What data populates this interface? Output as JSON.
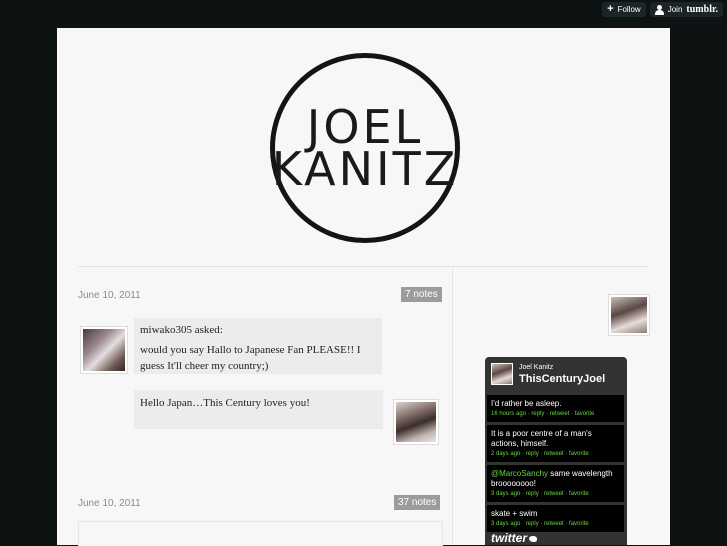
{
  "tumblr_controls": {
    "follow_label": "Follow",
    "join_label": "Join",
    "tumblr_label": "tumblr."
  },
  "logo": {
    "line1": "JOEL",
    "line2": "KANITZ"
  },
  "posts": [
    {
      "date": "June 10, 2011",
      "notes": "7 notes",
      "asker": "miwako305 asked:",
      "question": "would you say Hallo to Japanese Fan PLEASE!! I guess It'll cheer my country;)",
      "answer": "Hello Japan…This Century loves you!"
    },
    {
      "date": "June 10, 2011",
      "notes": "37 notes"
    }
  ],
  "twitter": {
    "name": "Joel Kanitz",
    "handle": "ThisCenturyJoel",
    "tweets": [
      {
        "text": "I'd rather be asleep.",
        "meta": "16 hours ago · reply · retweet · favorite"
      },
      {
        "text": "It is a poor centre of a man's actions, himself.",
        "meta": "2 days ago · reply · retweet · favorite"
      },
      {
        "mention": "@MarcoSanchy",
        "text": " same wavelength broooooooo!",
        "meta": "3 days ago · reply · retweet · favorite"
      },
      {
        "text": "skate + swim",
        "meta": "3 days ago · reply · retweet · favorite"
      }
    ],
    "footer": "twitter"
  }
}
